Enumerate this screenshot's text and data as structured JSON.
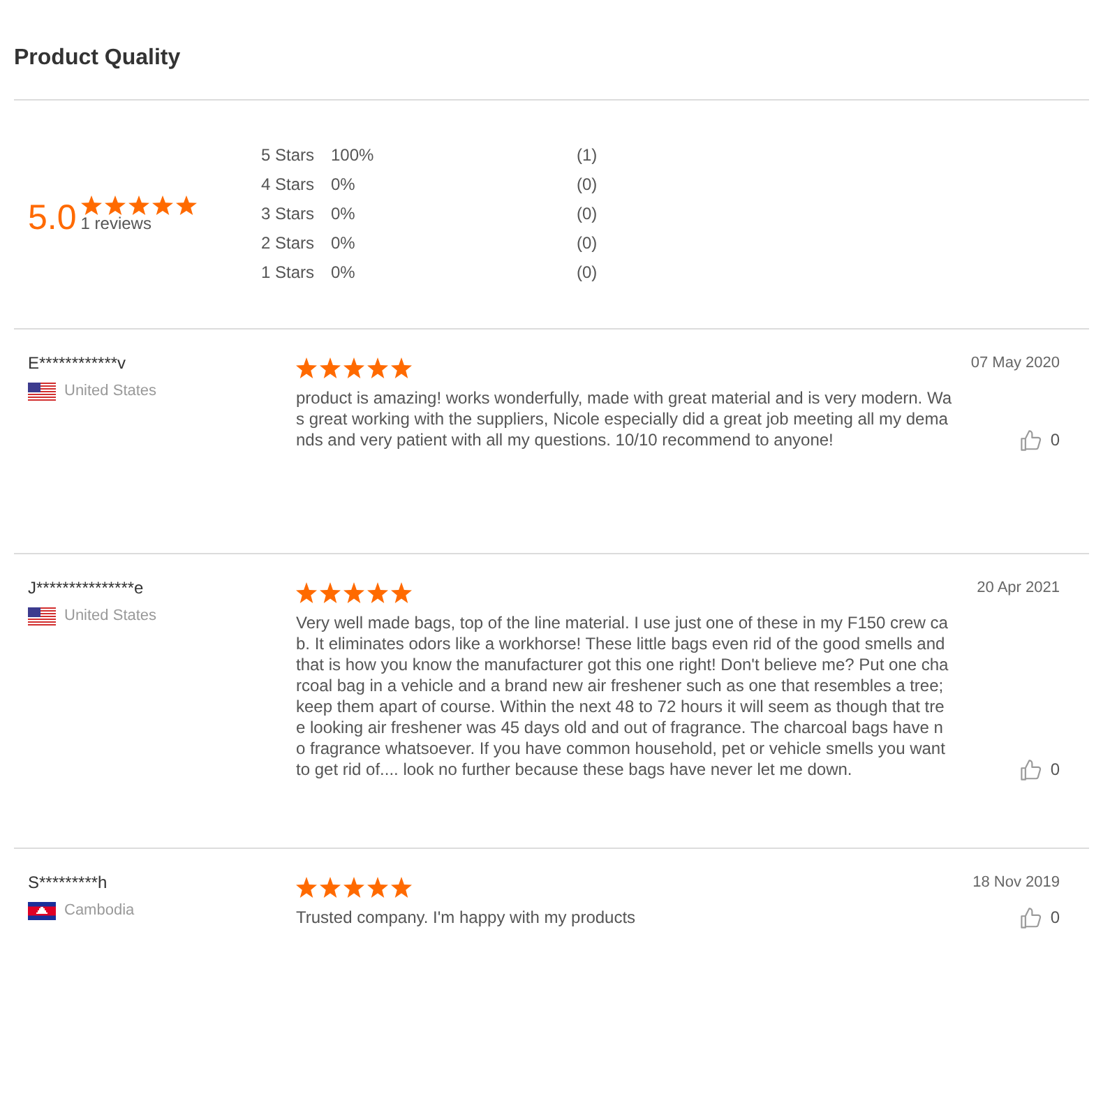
{
  "title": "Product Quality",
  "summary": {
    "score": "5.0",
    "stars": 5,
    "review_count": "1 reviews"
  },
  "histogram": [
    {
      "label": "5 Stars",
      "percent": "100%",
      "count": "(1)"
    },
    {
      "label": "4 Stars",
      "percent": "0%",
      "count": "(0)"
    },
    {
      "label": "3 Stars",
      "percent": "0%",
      "count": "(0)"
    },
    {
      "label": "2 Stars",
      "percent": "0%",
      "count": "(0)"
    },
    {
      "label": "1 Stars",
      "percent": "0%",
      "count": "(0)"
    }
  ],
  "reviews": [
    {
      "name": "E************v",
      "flag": {
        "kind": "us"
      },
      "country": "United States",
      "stars": 5,
      "text": "product is amazing! works wonderfully, made with great material and is very modern. Was great working with the suppliers, Nicole especially did a great job meeting all my demands and very patient with all my questions. 10/10 recommend to anyone!",
      "date": "07 May 2020",
      "likes": "0"
    },
    {
      "name": "J***************e",
      "flag": {
        "kind": "us"
      },
      "country": "United States",
      "stars": 5,
      "text": "Very well made bags, top of the line material. I use just one of these in my F150 crew cab. It eliminates odors like a workhorse! These little bags even rid of the good smells and that is how you know the manufacturer got this one right! Don't believe me? Put one charcoal bag in a vehicle and a brand new air freshener such as one that resembles a tree; keep them apart of course. Within the next 48 to 72 hours it will seem as though that tree looking air freshener was 45 days old and out of fragrance. The charcoal bags have no fragrance whatsoever. If you have common household, pet or vehicle smells you want to get rid of.... look no further because these bags have never let me down.",
      "date": "20 Apr 2021",
      "likes": "0"
    },
    {
      "name": "S*********h",
      "flag": {
        "kind": "kh"
      },
      "country": "Cambodia",
      "stars": 5,
      "text": "Trusted company. I'm happy with my products",
      "date": "18 Nov 2019",
      "likes": "0"
    }
  ]
}
